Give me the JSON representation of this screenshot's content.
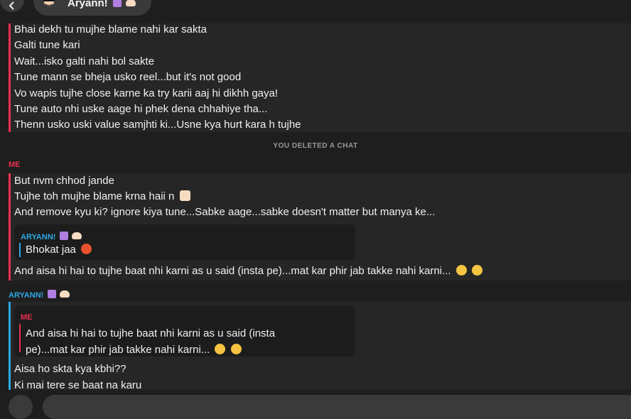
{
  "header": {
    "contact_name": "Aryann!"
  },
  "friend_block": {
    "lines": [
      "Bhai dekh tu mujhe blame nahi kar sakta",
      "Galti tune kari",
      "Wait...isko galti nahi bol sakte",
      "Tune mann se bheja usko reel...but it's not good",
      "Vo wapis tujhe close karne ka try karii aaj hi dikhh gaya!",
      "Tune auto nhi uske aage hi phek dena chhahiye tha...",
      "Thenn usko uski value samjhti ki...Usne kya hurt kara h tujhe"
    ]
  },
  "system_message": "YOU DELETED A CHAT",
  "me_block": {
    "sender": "ME",
    "lines": [
      "But nvm chhod jande",
      "Tujhe toh mujhe blame krna haii n",
      "And remove kyu ki? ignore kiya tune...Sabke aage...sabke doesn't matter but manya ke..."
    ],
    "quote": {
      "sender": "ARYANN!",
      "text": "Bhokat jaa"
    },
    "last_line": "And aisa hi hai to tujhe baat nhi karni as u said (insta pe)...mat kar phir jab takke nahi karni..."
  },
  "aryann_block": {
    "sender": "ARYANN!",
    "quote": {
      "sender": "ME",
      "line1": "And aisa hi hai to tujhe baat nhi karni as u said (insta",
      "line2": "pe)...mat kar phir jab takke nahi karni..."
    },
    "lines": [
      "Aisa ho skta kya kbhi??",
      "Ki mai tere se baat na karu"
    ]
  },
  "colors": {
    "me_accent": "#e9314f",
    "friend_accent": "#2ea8e5",
    "background": "#1e1e1e",
    "bubble": "#262626"
  },
  "icons": {
    "back": "chevron-left-icon",
    "heart": "purple-heart-icon",
    "hand": "hand-icon",
    "thumbs_up": "thumbs-up-icon",
    "angry": "angry-face-icon",
    "slight_smile": "slightly-smiling-face-icon",
    "grin": "grinning-face-icon"
  }
}
